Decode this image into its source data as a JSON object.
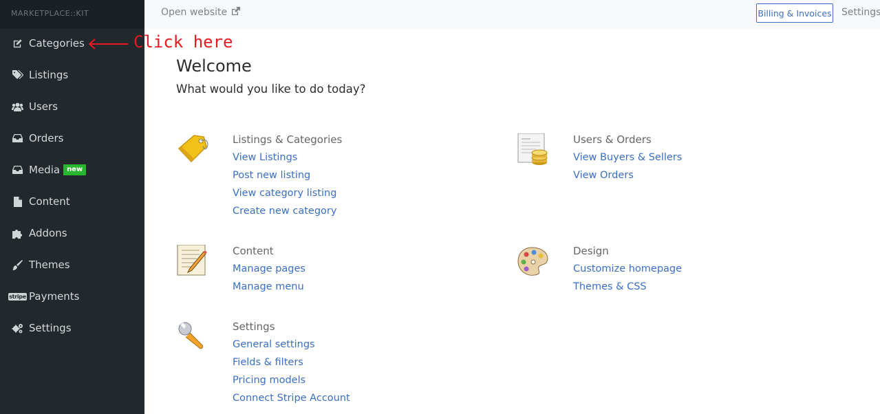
{
  "brand": "MARKETPLACE::KIT",
  "sidebar": {
    "items": [
      {
        "label": "Categories",
        "icon": "edit-icon"
      },
      {
        "label": "Listings",
        "icon": "tags-icon"
      },
      {
        "label": "Users",
        "icon": "users-icon"
      },
      {
        "label": "Orders",
        "icon": "inbox-icon"
      },
      {
        "label": "Media",
        "icon": "inbox-icon",
        "badge": "new"
      },
      {
        "label": "Content",
        "icon": "file-icon"
      },
      {
        "label": "Addons",
        "icon": "puzzle-icon"
      },
      {
        "label": "Themes",
        "icon": "brush-icon"
      },
      {
        "label": "Payments",
        "icon": "stripe-icon",
        "icon_text": "stripe"
      },
      {
        "label": "Settings",
        "icon": "gears-icon"
      }
    ]
  },
  "topbar": {
    "open_website": "Open website",
    "billing": "Billing & Invoices",
    "settings": "Settings"
  },
  "annotation": {
    "text": "Click here",
    "color": "#e8191f"
  },
  "main": {
    "welcome": "Welcome",
    "subtitle": "What would you like to do today?",
    "sections": [
      {
        "heading": "Listings & Categories",
        "icon": "price-tag-icon",
        "links": [
          "View Listings",
          "Post new listing",
          "View category listing",
          "Create new category"
        ]
      },
      {
        "heading": "Users & Orders",
        "icon": "invoice-coins-icon",
        "links": [
          "View Buyers & Sellers",
          "View Orders"
        ]
      },
      {
        "heading": "Content",
        "icon": "notepad-pencil-icon",
        "links": [
          "Manage pages",
          "Manage menu"
        ]
      },
      {
        "heading": "Design",
        "icon": "palette-icon",
        "links": [
          "Customize homepage",
          "Themes & CSS"
        ]
      },
      {
        "heading": "Settings",
        "icon": "wrench-icon",
        "links": [
          "General settings",
          "Fields & filters",
          "Pricing models",
          "Connect Stripe Account"
        ]
      }
    ]
  },
  "colors": {
    "sidebar_bg": "#22282c",
    "link": "#3a6fc5",
    "badge_new": "#2ab52e"
  }
}
